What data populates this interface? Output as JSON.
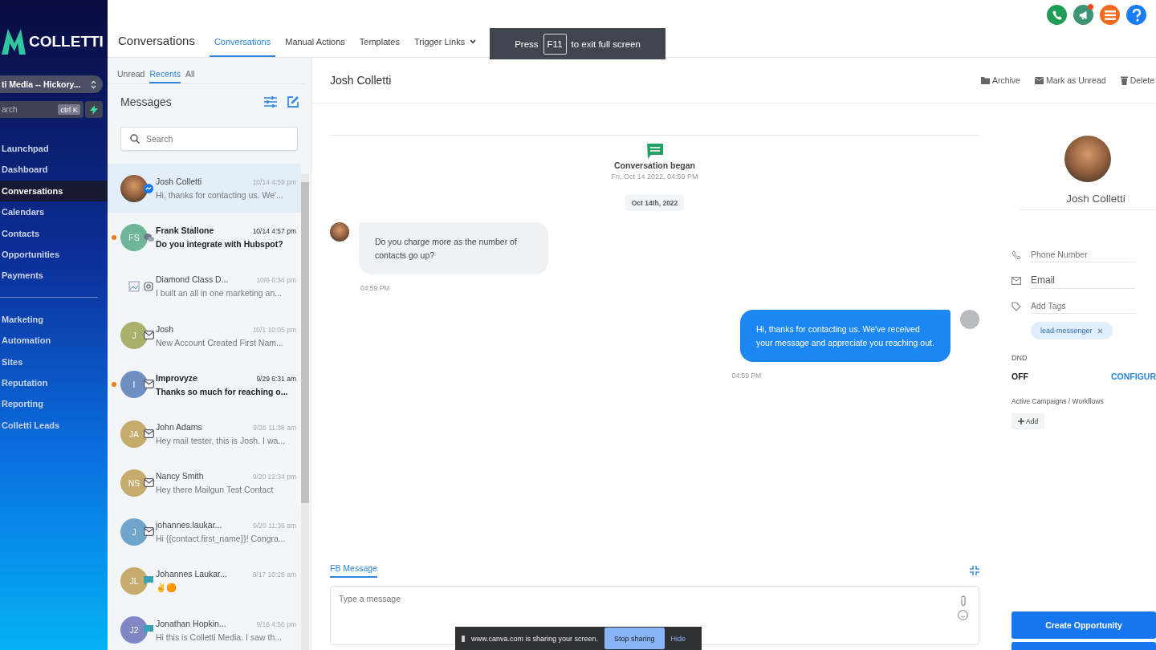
{
  "brand": {
    "name": "COLLETTI"
  },
  "sidebar": {
    "account": "ti Media -- Hickory...",
    "search": {
      "placeholder": "arch",
      "shortcut": "ctrl K"
    },
    "items": [
      {
        "label": "Launchpad",
        "selected": false
      },
      {
        "label": "Dashboard",
        "selected": false
      },
      {
        "label": "Conversations",
        "selected": true
      },
      {
        "label": "Calendars",
        "selected": false
      },
      {
        "label": "Contacts",
        "selected": false
      },
      {
        "label": "Opportunities",
        "selected": false
      },
      {
        "label": "Payments",
        "selected": false
      }
    ],
    "items_2": [
      {
        "label": "Marketing",
        "selected": false
      },
      {
        "label": "Automation",
        "selected": false
      },
      {
        "label": "Sites",
        "selected": false
      },
      {
        "label": "Reputation",
        "selected": false
      },
      {
        "label": "Reporting",
        "selected": false
      },
      {
        "label": "Colletti Leads",
        "selected": false
      }
    ]
  },
  "header": {
    "title": "Conversations",
    "tabs": [
      {
        "label": "Conversations",
        "selected": true,
        "dropdown": false
      },
      {
        "label": "Manual Actions",
        "selected": false,
        "dropdown": false
      },
      {
        "label": "Templates",
        "selected": false,
        "dropdown": false
      },
      {
        "label": "Trigger Links",
        "selected": false,
        "dropdown": true
      }
    ]
  },
  "fullscreen_toast": {
    "before": "Press",
    "key": "F11",
    "after": "to exit full screen"
  },
  "list": {
    "filters": [
      {
        "label": "Unread",
        "selected": false
      },
      {
        "label": "Recents",
        "selected": true
      },
      {
        "label": "All",
        "selected": false
      }
    ],
    "title": "Messages",
    "search": {
      "placeholder": "Search"
    },
    "items": [
      {
        "name": "Josh Colletti",
        "time": "10/14 4:59 pm",
        "preview": "Hi, thanks for contacting us. We'...",
        "avatar": {
          "kind": "photo"
        },
        "channel": {
          "kind": "messenger"
        },
        "unread": false,
        "selected": true
      },
      {
        "name": "Frank Stallone",
        "time": "10/14 4:57 pm",
        "preview": "Do you integrate with Hubspot?",
        "avatar": {
          "kind": "initials",
          "text": "FS",
          "color": "#6fb59a"
        },
        "channel": {
          "kind": "chat"
        },
        "unread": true,
        "selected": false
      },
      {
        "name": "Diamond Class D...",
        "time": "10/6 6:34 pm",
        "preview": "I built an all in one marketing an...",
        "avatar": {
          "kind": "broken"
        },
        "channel": {
          "kind": "instagram"
        },
        "unread": false,
        "selected": false
      },
      {
        "name": "Josh",
        "time": "10/1 10:05 pm",
        "preview": "New Account Created First Nam...",
        "avatar": {
          "kind": "initials",
          "text": "J",
          "color": "#aab16b"
        },
        "channel": {
          "kind": "email"
        },
        "unread": false,
        "selected": false
      },
      {
        "name": "Improvyze",
        "time": "9/29 6:31 am",
        "preview": "Thanks so much for reaching o...",
        "avatar": {
          "kind": "initials",
          "text": "I",
          "color": "#6f8fc2"
        },
        "channel": {
          "kind": "email"
        },
        "unread": true,
        "selected": false
      },
      {
        "name": "John Adams",
        "time": "9/26 11:38 am",
        "preview": "Hey mail tester, this is Josh. I wa...",
        "avatar": {
          "kind": "initials",
          "text": "JA",
          "color": "#c5ab6c"
        },
        "channel": {
          "kind": "email"
        },
        "unread": false,
        "selected": false
      },
      {
        "name": "Nancy Smith",
        "time": "9/20 12:34 pm",
        "preview": "Hey there Mailgun Test Contact",
        "avatar": {
          "kind": "initials",
          "text": "NS",
          "color": "#c5ab6c"
        },
        "channel": {
          "kind": "email"
        },
        "unread": false,
        "selected": false
      },
      {
        "name": "johannes.laukar...",
        "time": "9/20 11:36 am",
        "preview": "Hi {{contact.first_name}}! Congra...",
        "avatar": {
          "kind": "initials",
          "text": "J",
          "color": "#6fa5cb"
        },
        "channel": {
          "kind": "email"
        },
        "unread": false,
        "selected": false
      },
      {
        "name": "Johannes Laukar...",
        "time": "9/17 10:28 am",
        "preview": "✌🟠",
        "avatar": {
          "kind": "initials",
          "text": "JL",
          "color": "#c5ab6c"
        },
        "channel": {
          "kind": "sms"
        },
        "unread": false,
        "selected": false
      },
      {
        "name": "Jonathan Hopkin...",
        "time": "9/16 4:56 pm",
        "preview": "Hi this is Colletti Media. I saw th...",
        "avatar": {
          "kind": "initials",
          "text": "J2",
          "color": "#7f87c4"
        },
        "channel": {
          "kind": "sms"
        },
        "unread": false,
        "selected": false
      }
    ]
  },
  "conversation": {
    "contact": "Josh Colletti",
    "actions": [
      {
        "label": "Archive",
        "kind": "archive"
      },
      {
        "label": "Mark as Unread",
        "kind": "unread"
      },
      {
        "label": "Delete",
        "kind": "delete"
      }
    ],
    "began": {
      "title": "Conversation began",
      "date": "Fri, Oct 14 2022, 04:59 PM"
    },
    "day": "Oct 14th, 2022",
    "messages": [
      {
        "kind": "in",
        "text": "Do you charge more as the number of contacts go up?",
        "time": "04:59 PM"
      },
      {
        "kind": "out",
        "text": "Hi, thanks for contacting us. We've received your message and appreciate you reaching out.",
        "time": "04:59 PM"
      }
    ],
    "composer": {
      "tab": "FB Message",
      "placeholder": "Type a message"
    }
  },
  "contact_panel": {
    "name": "Josh Colletti",
    "fields": [
      {
        "kind": "phone",
        "placeholder": "Phone Number"
      },
      {
        "kind": "email",
        "value": "Email"
      },
      {
        "kind": "tag",
        "placeholder": "Add Tags"
      }
    ],
    "tags": [
      "lead-messenger"
    ],
    "dnd": {
      "label": "DND",
      "value": "OFF",
      "action": "CONFIGUR"
    },
    "campaigns": {
      "label": "Active Campaigns / Workflows",
      "add": "Add"
    },
    "buttons": [
      "Create Opportunity"
    ]
  },
  "share_bar": {
    "text": "www.canva.com is sharing your screen.",
    "stop": "Stop sharing",
    "hide": "Hide"
  }
}
